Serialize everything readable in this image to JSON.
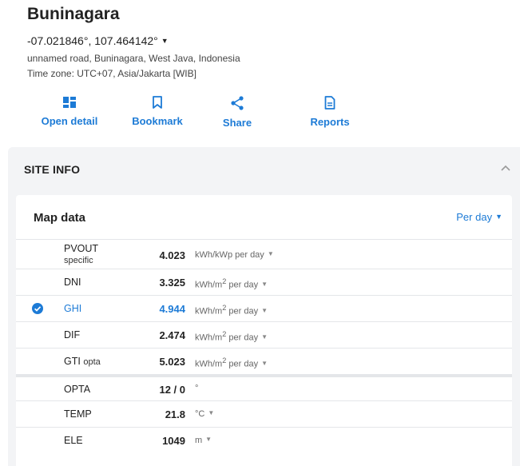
{
  "site": {
    "title": "Buninagara",
    "coords": "-07.021846°, 107.464142°",
    "address": "unnamed road, Buninagara, West Java, Indonesia",
    "timezone": "Time zone: UTC+07, Asia/Jakarta [WIB]"
  },
  "actions": [
    {
      "label": "Open detail",
      "icon": "dashboard-icon"
    },
    {
      "label": "Bookmark",
      "icon": "bookmark-icon"
    },
    {
      "label": "Share",
      "icon": "share-icon"
    },
    {
      "label": "Reports",
      "icon": "document-icon"
    }
  ],
  "site_info": {
    "heading": "SITE INFO",
    "map_data_heading": "Map data",
    "period": "Per day",
    "rows": [
      {
        "name": "PVOUT",
        "sub": "specific",
        "value": "4.023",
        "unit": "kWh/kWp per day",
        "selected": false
      },
      {
        "name": "DNI",
        "sub": "",
        "value": "3.325",
        "unit_pre": "kWh/m",
        "unit_sup": "2",
        "unit_post": " per day",
        "selected": false
      },
      {
        "name": "GHI",
        "sub": "",
        "value": "4.944",
        "unit_pre": "kWh/m",
        "unit_sup": "2",
        "unit_post": " per day",
        "selected": true
      },
      {
        "name": "DIF",
        "sub": "",
        "value": "2.474",
        "unit_pre": "kWh/m",
        "unit_sup": "2",
        "unit_post": " per day",
        "selected": false
      },
      {
        "name": "GTI",
        "sub": "opta",
        "value": "5.023",
        "unit_pre": "kWh/m",
        "unit_sup": "2",
        "unit_post": " per day",
        "selected": false
      },
      {
        "name": "OPTA",
        "sub": "",
        "value": "12 / 0",
        "unit": "°",
        "selected": false
      },
      {
        "name": "TEMP",
        "sub": "",
        "value": "21.8",
        "unit": "°C",
        "selected": false
      },
      {
        "name": "ELE",
        "sub": "",
        "value": "1049",
        "unit": "m",
        "selected": false
      }
    ]
  },
  "colors": {
    "accent": "#1d7bd6",
    "panel": "#f3f4f6"
  }
}
